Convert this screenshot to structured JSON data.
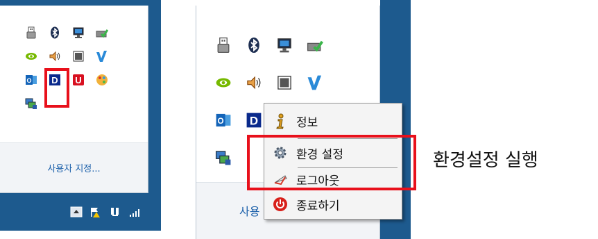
{
  "left_tray": {
    "customize_link": "사용자 지정...",
    "icons": [
      "usb-drive-icon",
      "bluetooth-icon",
      "network-monitor-icon",
      "network-check-icon",
      "nvidia-icon",
      "speaker-icon",
      "window-icon",
      "vmware-icon",
      "outlook-icon",
      "d-app-icon",
      "u-app-icon",
      "color-palette-icon",
      "network-update-icon"
    ],
    "highlighted_icon": "d-app-icon"
  },
  "taskbar": {
    "icons": [
      "show-hidden-icons-button",
      "action-center-flag-icon",
      "network-icon",
      "signal-bars-icon"
    ]
  },
  "right_tray": {
    "customize_link_partial": "사용",
    "icons": [
      "usb-drive-icon",
      "bluetooth-icon",
      "network-monitor-icon",
      "network-check-icon",
      "nvidia-icon",
      "speaker-icon",
      "window-icon",
      "vmware-icon",
      "outlook-icon",
      "d-app-icon",
      "network-update-icon"
    ]
  },
  "context_menu": {
    "items": [
      {
        "label": "정보",
        "icon": "info-icon"
      },
      {
        "label": "환경 설정",
        "icon": "settings-gear-icon"
      },
      {
        "label": "로그아웃",
        "icon": "logout-icon"
      },
      {
        "label": "종료하기",
        "icon": "power-icon"
      }
    ],
    "highlighted_item": "환경 설정"
  },
  "callout_text": "환경설정 실행",
  "colors": {
    "highlight": "#e8101b",
    "taskbar": "#1d5a8e",
    "link": "#1a5faa"
  }
}
